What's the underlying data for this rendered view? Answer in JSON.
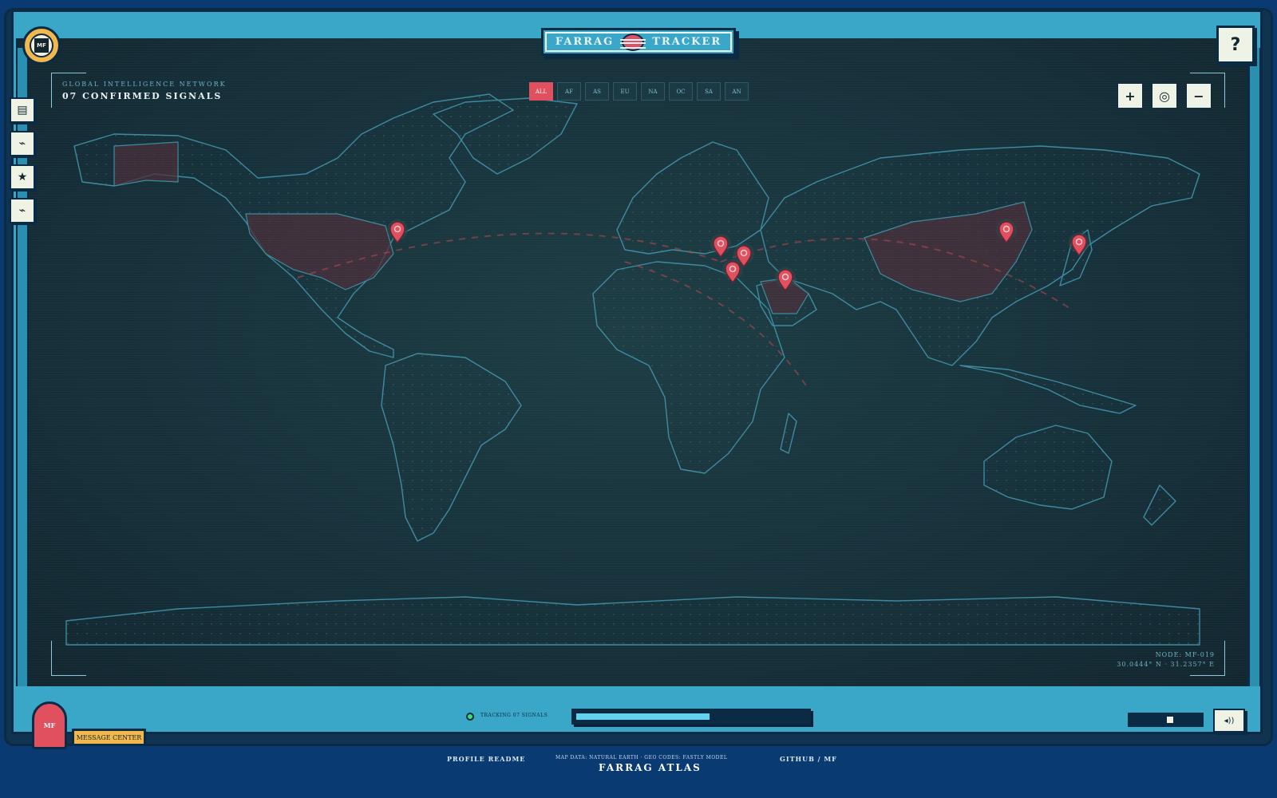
{
  "header": {
    "title_left": "FARRAG",
    "title_right": "TRACKER",
    "avatar_initials": "MF",
    "help_label": "?"
  },
  "left_toolbar": [
    {
      "icon": "document-icon",
      "glyph": "▤"
    },
    {
      "icon": "activity-icon",
      "glyph": "⌁"
    },
    {
      "icon": "star-icon",
      "glyph": "★"
    },
    {
      "icon": "signal-icon",
      "glyph": "⌁"
    }
  ],
  "map": {
    "network_label": "GLOBAL INTELLIGENCE NETWORK",
    "signal_count": "07 CONFIRMED SIGNALS",
    "filters": [
      "ALL",
      "AF",
      "AS",
      "EU",
      "NA",
      "OC",
      "SA",
      "AN"
    ],
    "active_filter": "ALL",
    "zoom_in_label": "+",
    "recenter_label": "◎",
    "zoom_out_label": "−",
    "node_id": "NODE: MF-019",
    "node_coords": "30.0444° N · 31.2357° E",
    "markers": 7
  },
  "bottom_bar": {
    "avatar_initials": "MF",
    "message_center_label": "MESSAGE CENTER",
    "tracking_label": "TRACKING 07 SIGNALS",
    "progress_fraction": 0.6,
    "volume_fraction": 0.55,
    "speaker_label": "◂))"
  },
  "footer": {
    "profile_link": "PROFILE README",
    "credit": "MAP DATA: NATURAL EARTH · GEO CODES: FASTLY MODEL",
    "brand": "FARRAG ATLAS",
    "github_link": "GITHUB / MF"
  },
  "colors": {
    "accent_red": "#e0505e",
    "frame_blue": "#3aa6c8",
    "gold": "#f2b84b",
    "land_outline": "#3d8aa0"
  }
}
